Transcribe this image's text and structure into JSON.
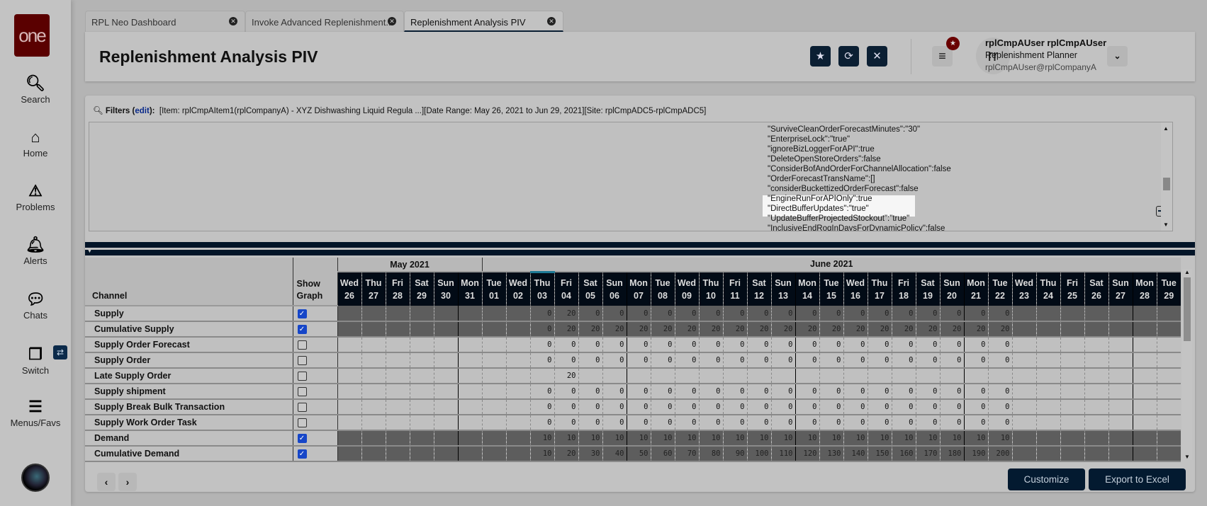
{
  "logo_text": "one",
  "sidebar": {
    "items": [
      {
        "label": "Search",
        "icon": "search-icon"
      },
      {
        "label": "Home",
        "icon": "home-icon"
      },
      {
        "label": "Problems",
        "icon": "warning-icon"
      },
      {
        "label": "Alerts",
        "icon": "bell-icon"
      },
      {
        "label": "Chats",
        "icon": "chat-icon"
      },
      {
        "label": "Switch",
        "icon": "switch-icon"
      },
      {
        "label": "Menus/Favs",
        "icon": "menu-icon"
      }
    ]
  },
  "tabs": [
    {
      "label": "RPL Neo Dashboard"
    },
    {
      "label": "Invoke Advanced Replenishment..."
    },
    {
      "label": "Replenishment Analysis PIV"
    }
  ],
  "header": {
    "title": "Replenishment Analysis PIV",
    "user_initials": "rr",
    "user_name": "rplCmpAUser rplCmpAUser",
    "user_role": "Replenishment Planner",
    "user_email": "rplCmpAUser@rplCompanyA"
  },
  "filters": {
    "label": "Filters",
    "edit": "edit",
    "text": "[Item: rplCmpAItem1(rplCompanyA) - XYZ Dishwashing Liquid Regula ...][Date Range: May 26, 2021 to Jun 29, 2021][Site: rplCmpADC5-rplCmpADC5]"
  },
  "properties": [
    "\"SurviveCleanOrderForecastMinutes\":\"30\"",
    "\"EnterpriseLock\":\"true\"",
    "\"ignoreBizLoggerForAPI\":true",
    "\"DeleteOpenStoreOrders\":false",
    "\"ConsiderBofAndOrderForChannelAllocation\":false",
    "\"OrderForecastTransName\":[]",
    "\"considerBuckettizedOrderForecast\":false",
    "\"EngineRunForAPIOnly\":true",
    "\"DirectBufferUpdates\":\"true\"",
    "\"UpdateBufferProjectedStockout\":\"true\"",
    "\"InclusiveEndRoqInDaysForDynamicPolicy\":false"
  ],
  "table": {
    "channel_header": "Channel",
    "show_graph_header": "Show Graph",
    "months": [
      {
        "label": "May 2021",
        "days": 6
      },
      {
        "label": "June 2021",
        "days": 29
      }
    ],
    "days": [
      [
        "Wed",
        "26"
      ],
      [
        "Thu",
        "27"
      ],
      [
        "Fri",
        "28"
      ],
      [
        "Sat",
        "29"
      ],
      [
        "Sun",
        "30"
      ],
      [
        "Mon",
        "31"
      ],
      [
        "Tue",
        "01"
      ],
      [
        "Wed",
        "02"
      ],
      [
        "Thu",
        "03"
      ],
      [
        "Fri",
        "04"
      ],
      [
        "Sat",
        "05"
      ],
      [
        "Sun",
        "06"
      ],
      [
        "Mon",
        "07"
      ],
      [
        "Tue",
        "08"
      ],
      [
        "Wed",
        "09"
      ],
      [
        "Thu",
        "10"
      ],
      [
        "Fri",
        "11"
      ],
      [
        "Sat",
        "12"
      ],
      [
        "Sun",
        "13"
      ],
      [
        "Mon",
        "14"
      ],
      [
        "Tue",
        "15"
      ],
      [
        "Wed",
        "16"
      ],
      [
        "Thu",
        "17"
      ],
      [
        "Fri",
        "18"
      ],
      [
        "Sat",
        "19"
      ],
      [
        "Sun",
        "20"
      ],
      [
        "Mon",
        "21"
      ],
      [
        "Tue",
        "22"
      ],
      [
        "Wed",
        "23"
      ],
      [
        "Thu",
        "24"
      ],
      [
        "Fri",
        "25"
      ],
      [
        "Sat",
        "26"
      ],
      [
        "Sun",
        "27"
      ],
      [
        "Mon",
        "28"
      ],
      [
        "Tue",
        "29"
      ]
    ],
    "today_index": 8,
    "rows": [
      {
        "channel": "Supply",
        "show_graph": true,
        "shaded": true,
        "values": [
          null,
          null,
          null,
          null,
          null,
          null,
          null,
          null,
          0,
          20,
          0,
          0,
          0,
          0,
          0,
          0,
          0,
          0,
          0,
          0,
          0,
          0,
          0,
          0,
          0,
          0,
          0,
          0,
          null,
          null,
          null,
          null,
          null,
          null,
          null
        ]
      },
      {
        "channel": "Cumulative Supply",
        "show_graph": true,
        "shaded": true,
        "values": [
          null,
          null,
          null,
          null,
          null,
          null,
          null,
          null,
          0,
          20,
          20,
          20,
          20,
          20,
          20,
          20,
          20,
          20,
          20,
          20,
          20,
          20,
          20,
          20,
          20,
          20,
          20,
          20,
          null,
          null,
          null,
          null,
          null,
          null,
          null
        ]
      },
      {
        "channel": "Supply Order Forecast",
        "show_graph": false,
        "shaded": false,
        "values": [
          null,
          null,
          null,
          null,
          null,
          null,
          null,
          null,
          0,
          0,
          0,
          0,
          0,
          0,
          0,
          0,
          0,
          0,
          0,
          0,
          0,
          0,
          0,
          0,
          0,
          0,
          0,
          0,
          null,
          null,
          null,
          null,
          null,
          null,
          null
        ]
      },
      {
        "channel": "Supply Order",
        "show_graph": false,
        "shaded": false,
        "values": [
          null,
          null,
          null,
          null,
          null,
          null,
          null,
          null,
          0,
          0,
          0,
          0,
          0,
          0,
          0,
          0,
          0,
          0,
          0,
          0,
          0,
          0,
          0,
          0,
          0,
          0,
          0,
          0,
          null,
          null,
          null,
          null,
          null,
          null,
          null
        ]
      },
      {
        "channel": "Late Supply Order",
        "show_graph": false,
        "shaded": false,
        "values": [
          null,
          null,
          null,
          null,
          null,
          null,
          null,
          null,
          null,
          20,
          null,
          null,
          null,
          null,
          null,
          null,
          null,
          null,
          null,
          null,
          null,
          null,
          null,
          null,
          null,
          null,
          null,
          null,
          null,
          null,
          null,
          null,
          null,
          null,
          null
        ]
      },
      {
        "channel": "Supply shipment",
        "show_graph": false,
        "shaded": false,
        "values": [
          null,
          null,
          null,
          null,
          null,
          null,
          null,
          null,
          0,
          0,
          0,
          0,
          0,
          0,
          0,
          0,
          0,
          0,
          0,
          0,
          0,
          0,
          0,
          0,
          0,
          0,
          0,
          0,
          null,
          null,
          null,
          null,
          null,
          null,
          null
        ]
      },
      {
        "channel": "Supply Break Bulk Transaction",
        "show_graph": false,
        "shaded": false,
        "values": [
          null,
          null,
          null,
          null,
          null,
          null,
          null,
          null,
          0,
          0,
          0,
          0,
          0,
          0,
          0,
          0,
          0,
          0,
          0,
          0,
          0,
          0,
          0,
          0,
          0,
          0,
          0,
          0,
          null,
          null,
          null,
          null,
          null,
          null,
          null
        ]
      },
      {
        "channel": "Supply Work Order Task",
        "show_graph": false,
        "shaded": false,
        "values": [
          null,
          null,
          null,
          null,
          null,
          null,
          null,
          null,
          0,
          0,
          0,
          0,
          0,
          0,
          0,
          0,
          0,
          0,
          0,
          0,
          0,
          0,
          0,
          0,
          0,
          0,
          0,
          0,
          null,
          null,
          null,
          null,
          null,
          null,
          null
        ]
      },
      {
        "channel": "Demand",
        "show_graph": true,
        "shaded": true,
        "values": [
          null,
          null,
          null,
          null,
          null,
          null,
          null,
          null,
          10,
          10,
          10,
          10,
          10,
          10,
          10,
          10,
          10,
          10,
          10,
          10,
          10,
          10,
          10,
          10,
          10,
          10,
          10,
          10,
          null,
          null,
          null,
          null,
          null,
          null,
          null
        ]
      },
      {
        "channel": "Cumulative Demand",
        "show_graph": true,
        "shaded": true,
        "values": [
          null,
          null,
          null,
          null,
          null,
          null,
          null,
          null,
          10,
          20,
          30,
          40,
          50,
          60,
          70,
          80,
          90,
          100,
          110,
          120,
          130,
          140,
          150,
          160,
          170,
          180,
          190,
          200,
          null,
          null,
          null,
          null,
          null,
          null,
          null
        ]
      }
    ]
  },
  "footer": {
    "prev": "‹",
    "next": "›",
    "customize": "Customize",
    "export": "Export to Excel"
  },
  "colors": {
    "brand": "#5a0000",
    "primary_button": "#031a30",
    "checkbox": "#1646c8",
    "header_bg": "#020b16"
  }
}
